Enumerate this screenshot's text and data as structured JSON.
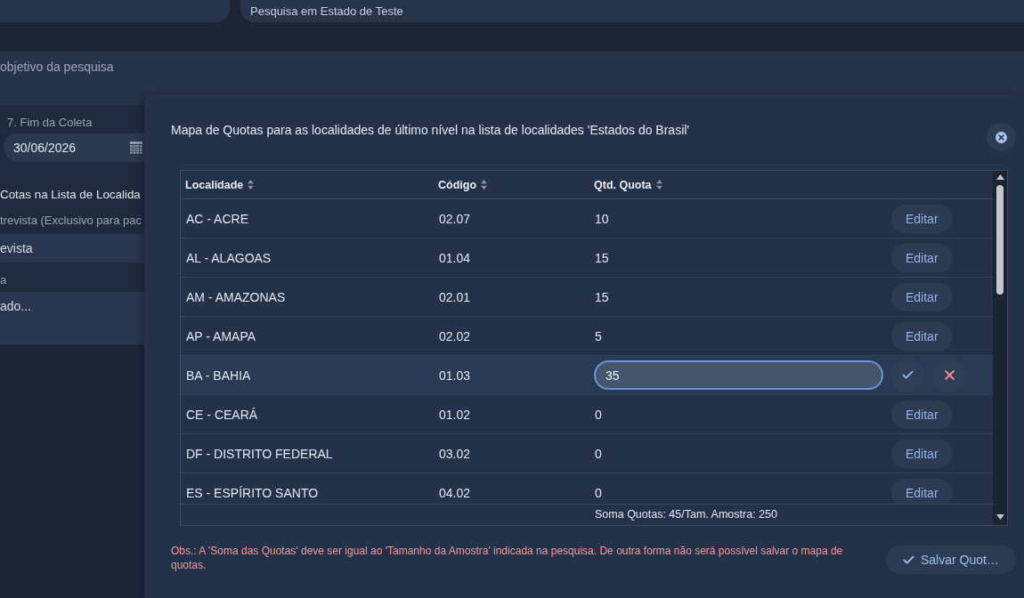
{
  "top_bar": {
    "survey_name": "Pesquisa em Estado de Teste"
  },
  "objective": {
    "text": "objetivo da pesquisa"
  },
  "form": {
    "end_date_label": "7. Fim da Coleta",
    "end_date_value": "30/06/2026",
    "section_title": "Cotas na Lista de Localida",
    "interview_label": "trevista (Exclusivo para pac",
    "interview_value": "evista",
    "list_label": "a",
    "list_value": "ado..."
  },
  "modal": {
    "title": "Mapa de Quotas para as localidades de último nível na lista de localidades 'Estados do Brasil'",
    "table": {
      "columns": [
        {
          "label": "Localidade"
        },
        {
          "label": "Código"
        },
        {
          "label": "Qtd. Quota"
        }
      ],
      "rows": [
        {
          "locality": "AC - ACRE",
          "code": "02.07",
          "quota": "10",
          "editing": false,
          "action": "Editar"
        },
        {
          "locality": "AL - ALAGOAS",
          "code": "01.04",
          "quota": "15",
          "editing": false,
          "action": "Editar"
        },
        {
          "locality": "AM - AMAZONAS",
          "code": "02.01",
          "quota": "15",
          "editing": false,
          "action": "Editar"
        },
        {
          "locality": "AP - AMAPA",
          "code": "02.02",
          "quota": "5",
          "editing": false,
          "action": "Editar"
        },
        {
          "locality": "BA - BAHIA",
          "code": "01.03",
          "quota": "35",
          "editing": true
        },
        {
          "locality": "CE - CEARÁ",
          "code": "01.02",
          "quota": "0",
          "editing": false,
          "action": "Editar"
        },
        {
          "locality": "DF - DISTRITO FEDERAL",
          "code": "03.02",
          "quota": "0",
          "editing": false,
          "action": "Editar"
        },
        {
          "locality": "ES - ESPÍRITO SANTO",
          "code": "04.02",
          "quota": "0",
          "editing": false,
          "action": "Editar"
        }
      ],
      "footer": "Soma Quotas: 45/Tam. Amostra: 250"
    },
    "note": "Obs.: A 'Soma das Quotas' deve ser igual ao 'Tamanho da Amostra' indicada na pesquisa. De outra forma não será possível salvar o mapa de quotas.",
    "save_button": "Salvar Quot…"
  }
}
